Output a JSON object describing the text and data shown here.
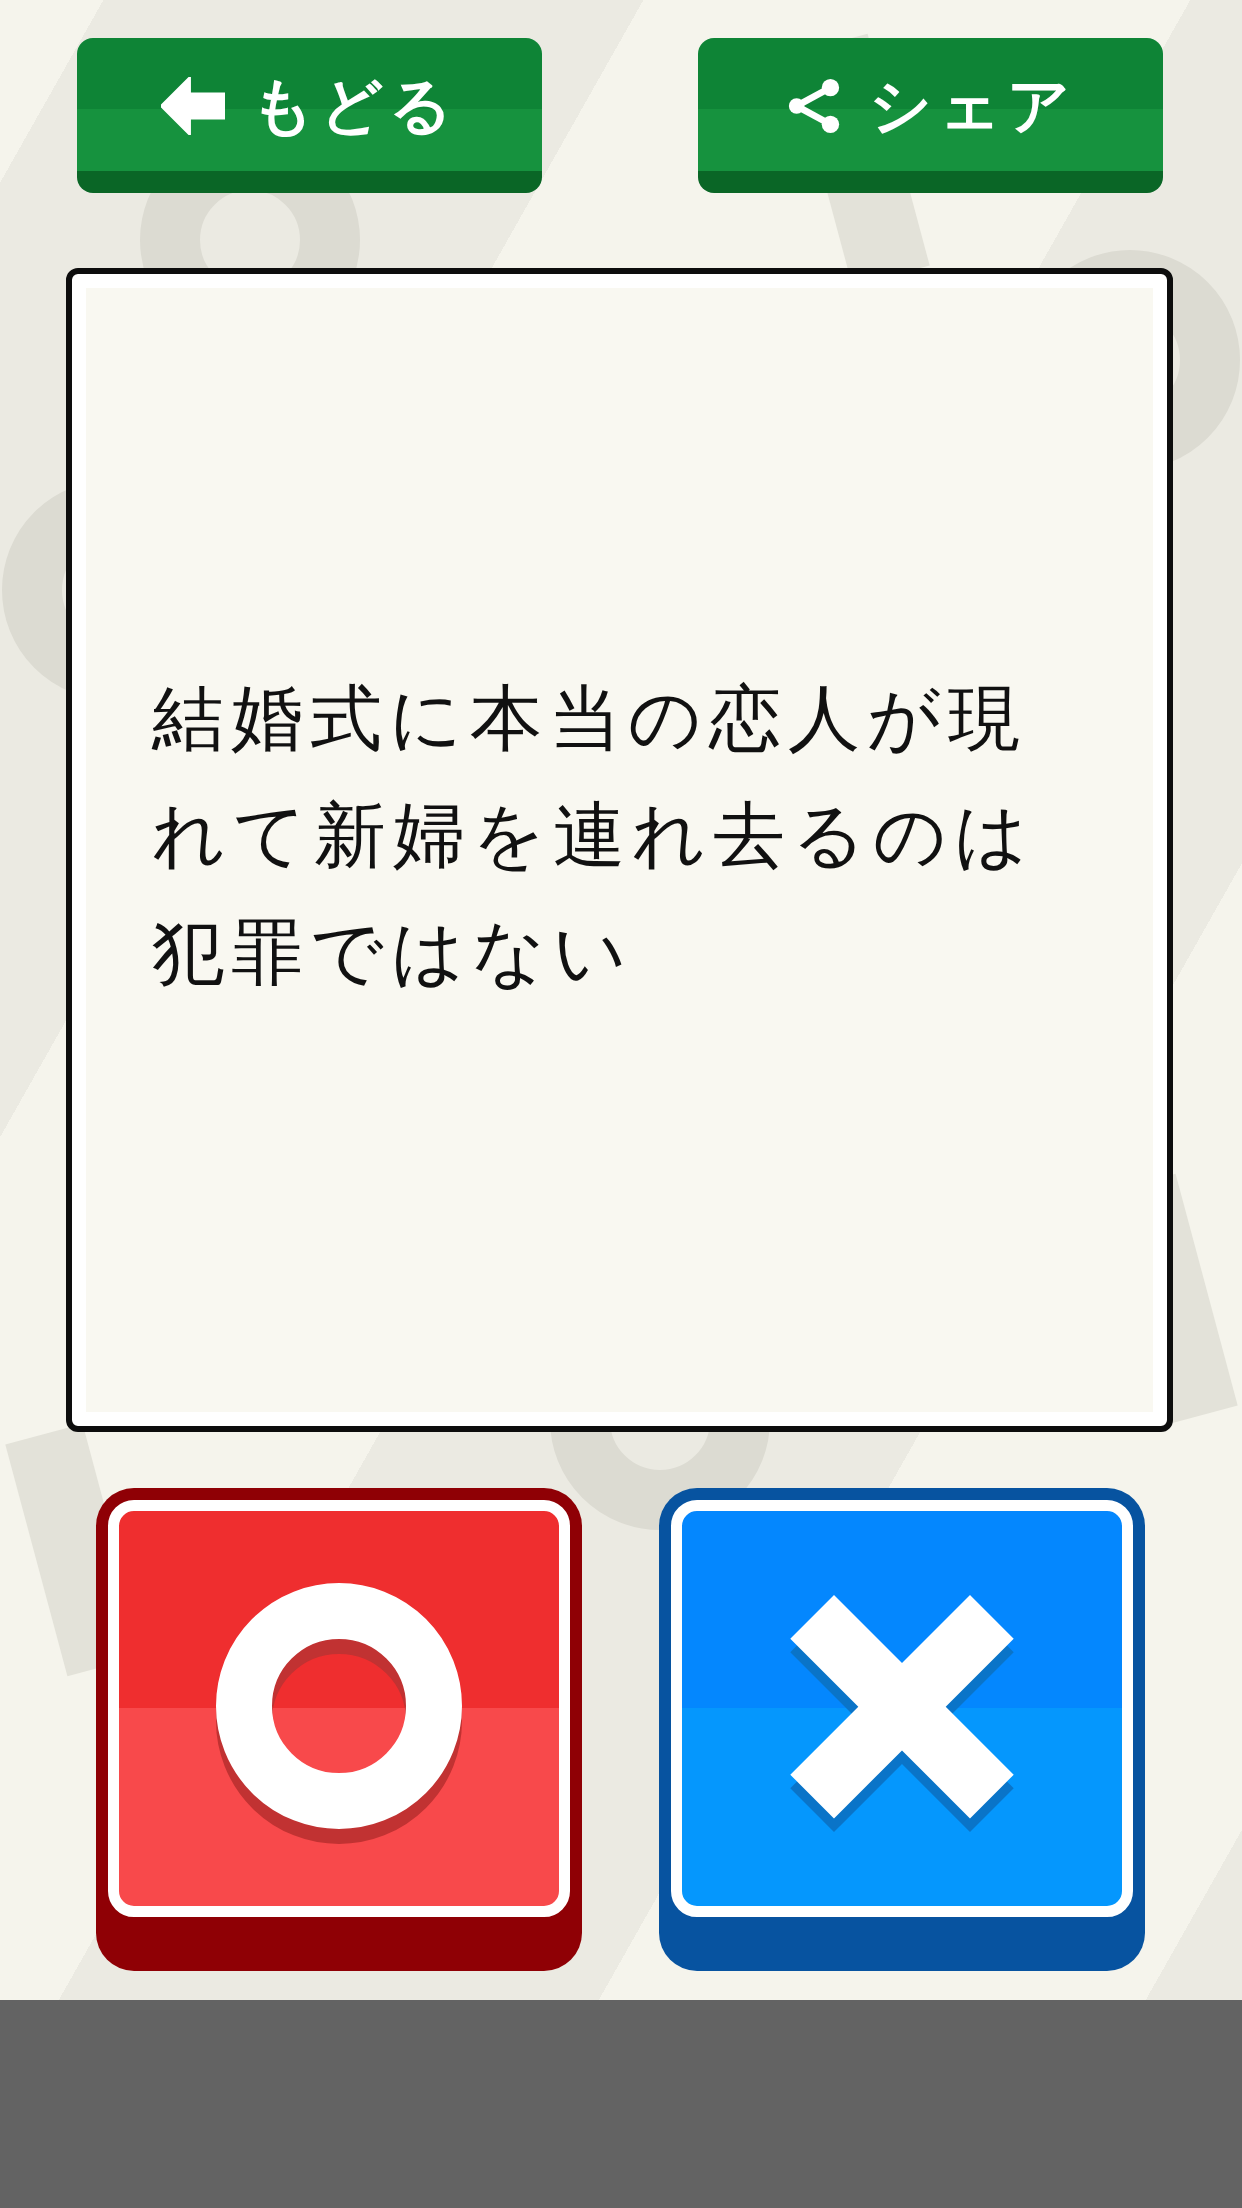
{
  "top_buttons": [
    {
      "kind": "back",
      "label": "もどる"
    },
    {
      "kind": "share",
      "label": "シェア"
    }
  ],
  "question": {
    "text": "結婚式に本当の恋人が現れて新婦を連れ去るのは犯罪ではない"
  },
  "answers": [
    {
      "kind": "circle"
    },
    {
      "kind": "cross"
    }
  ]
}
